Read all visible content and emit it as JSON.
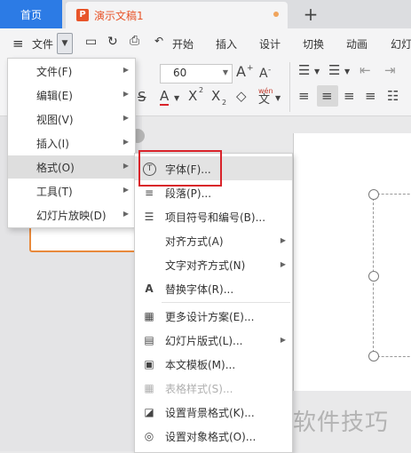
{
  "tabs": {
    "home": "首页",
    "doc_title": "演示文稿1",
    "doc_icon": "P",
    "add": "+"
  },
  "menubar": {
    "file": "文件",
    "items": [
      "开始",
      "插入",
      "设计",
      "切换",
      "动画",
      "幻灯"
    ]
  },
  "ribbon": {
    "font_size": "60",
    "grow_font": "A",
    "shrink_font": "A",
    "underline_s": "S",
    "font_color": "A",
    "superscript": "X",
    "superscript_mark": "2",
    "subscript": "X",
    "subscript_mark": "2",
    "phonetic": "wén",
    "phonetic_char": "文"
  },
  "main_menu": {
    "items": [
      {
        "label": "文件(F)"
      },
      {
        "label": "编辑(E)"
      },
      {
        "label": "视图(V)"
      },
      {
        "label": "插入(I)"
      },
      {
        "label": "格式(O)"
      },
      {
        "label": "工具(T)"
      },
      {
        "label": "幻灯片放映(D)"
      }
    ]
  },
  "format_submenu": {
    "items": [
      {
        "label": "字体(F)...",
        "icon": "T"
      },
      {
        "label": "段落(P)...",
        "icon": "≡"
      },
      {
        "label": "项目符号和编号(B)...",
        "icon": "☰"
      },
      {
        "label": "对齐方式(A)",
        "icon": ""
      },
      {
        "label": "文字对齐方式(N)",
        "icon": ""
      },
      {
        "label": "替换字体(R)...",
        "icon": "A"
      },
      {
        "label": "更多设计方案(E)...",
        "icon": "▦"
      },
      {
        "label": "幻灯片版式(L)...",
        "icon": "▤"
      },
      {
        "label": "本文模板(M)...",
        "icon": "▣"
      },
      {
        "label": "表格样式(S)...",
        "icon": "▦"
      },
      {
        "label": "设置背景格式(K)...",
        "icon": "◪"
      },
      {
        "label": "设置对象格式(O)...",
        "icon": "◎"
      }
    ]
  },
  "watermark": "软件技巧",
  "colors": {
    "tab_home_bg": "#2c7be5",
    "doc_accent": "#e8552a",
    "highlight_box": "#d9232a",
    "thumb_border": "#e8893c"
  }
}
